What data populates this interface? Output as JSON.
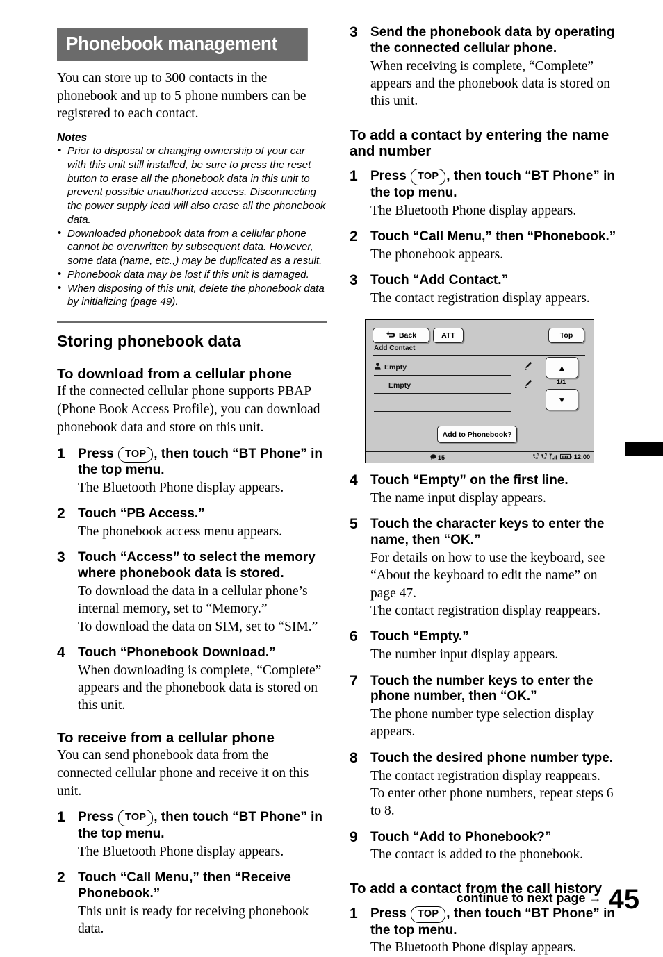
{
  "page": {
    "number": "45",
    "continue_label": "continue to next page",
    "continue_arrow": "→"
  },
  "banner": {
    "title": "Phonebook management"
  },
  "intro": "You can store up to 300 contacts in the phonebook and up to 5 phone numbers can be registered to each contact.",
  "notes": {
    "title": "Notes",
    "items": [
      "Prior to disposal or changing ownership of your car with this unit still installed, be sure to press the reset button to erase all the phonebook data in this unit to prevent possible unauthorized access. Disconnecting the power supply lead will also erase all the phonebook data.",
      "Downloaded phonebook data from a cellular phone cannot be overwritten by subsequent data. However, some data (name, etc.,) may be duplicated as a result.",
      "Phonebook data may be lost if this unit is damaged.",
      "When disposing of this unit, delete the phonebook data by initializing (page 49)."
    ]
  },
  "sections": {
    "storing": {
      "heading": "Storing phonebook data"
    },
    "download": {
      "heading": "To download from a cellular phone",
      "intro": "If the connected cellular phone supports PBAP (Phone Book Access Profile), you can download phonebook data and store on this unit.",
      "steps": [
        {
          "num": "1",
          "head_pre": "Press ",
          "key": "TOP",
          "head_post": ", then touch “BT Phone” in the top menu.",
          "desc": "The Bluetooth Phone display appears."
        },
        {
          "num": "2",
          "head": "Touch “PB Access.”",
          "desc": "The phonebook access menu appears."
        },
        {
          "num": "3",
          "head": "Touch “Access” to select the memory where phonebook data is stored.",
          "desc": "To download the data in a cellular phone’s internal memory, set to “Memory.”\nTo download the data on SIM, set to “SIM.”"
        },
        {
          "num": "4",
          "head": "Touch “Phonebook Download.”",
          "desc": "When downloading is complete, “Complete” appears and the phonebook data is stored on this unit."
        }
      ]
    },
    "receive": {
      "heading": "To receive from a cellular phone",
      "intro": "You can send phonebook data from the connected cellular phone and receive it on this unit.",
      "steps": [
        {
          "num": "1",
          "head_pre": "Press ",
          "key": "TOP",
          "head_post": ", then touch “BT Phone” in the top menu.",
          "desc": "The Bluetooth Phone display appears."
        },
        {
          "num": "2",
          "head": "Touch “Call Menu,” then “Receive Phonebook.”",
          "desc": "This unit is ready for receiving phonebook data."
        },
        {
          "num": "3",
          "head": "Send the phonebook data by operating the connected cellular phone.",
          "desc": "When receiving is complete, “Complete” appears and the phonebook data is stored on this unit."
        }
      ]
    },
    "add_by_name": {
      "heading": "To add a contact by entering the name and number",
      "steps_before_figure": [
        {
          "num": "1",
          "head_pre": "Press ",
          "key": "TOP",
          "head_post": ", then touch “BT Phone” in the top menu.",
          "desc": "The Bluetooth Phone display appears."
        },
        {
          "num": "2",
          "head": "Touch “Call Menu,” then “Phonebook.”",
          "desc": "The phonebook appears."
        },
        {
          "num": "3",
          "head": "Touch “Add Contact.”",
          "desc": "The contact registration display appears."
        }
      ],
      "steps_after_figure": [
        {
          "num": "4",
          "head": "Touch “Empty” on the first line.",
          "desc": "The name input display appears."
        },
        {
          "num": "5",
          "head": "Touch the character keys to enter the name, then “OK.”",
          "desc": "For details on how to use the keyboard, see “About the keyboard to edit the name” on page 47.\nThe contact registration display reappears."
        },
        {
          "num": "6",
          "head": "Touch “Empty.”",
          "desc": "The number input display appears."
        },
        {
          "num": "7",
          "head": "Touch the number keys to enter the phone number, then “OK.”",
          "desc": "The phone number type selection display appears."
        },
        {
          "num": "8",
          "head": "Touch the desired phone number type.",
          "desc": "The contact registration display reappears.\nTo enter other phone numbers, repeat steps 6 to 8."
        },
        {
          "num": "9",
          "head": "Touch “Add to Phonebook?”",
          "desc": "The contact is added to the phonebook."
        }
      ]
    },
    "add_from_history": {
      "heading": "To add a contact from the call history",
      "steps": [
        {
          "num": "1",
          "head_pre": "Press ",
          "key": "TOP",
          "head_post": ", then touch “BT Phone” in the top menu.",
          "desc": "The Bluetooth Phone display appears."
        }
      ]
    }
  },
  "figure": {
    "back_label": "Back",
    "att_label": "ATT",
    "top_label": "Top",
    "screen_title": "Add Contact",
    "row1_label": "Empty",
    "row2_label": "Empty",
    "pager": "1/1",
    "up_arrow": "▲",
    "down_arrow": "▼",
    "add_label": "Add to Phonebook?",
    "status_count": "15",
    "status_time": "12:00"
  },
  "colors": {
    "banner_bg": "#6b6b6b",
    "rule": "#6a6a6a",
    "screen_bg": "#c9c9c9",
    "button_bg": "#fdfdfd"
  }
}
